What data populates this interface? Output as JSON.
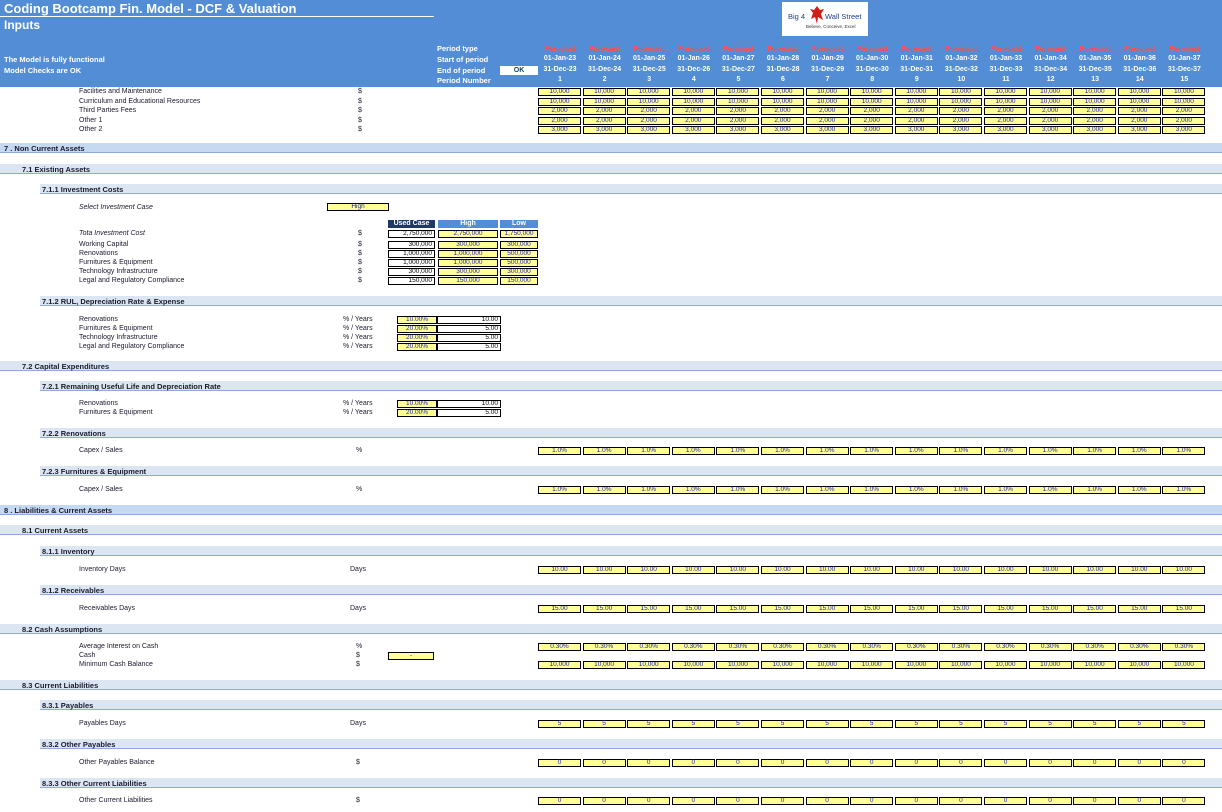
{
  "header": {
    "title": "Coding Bootcamp Fin. Model - DCF & Valuation",
    "subtitle": "Inputs",
    "status_functional": "The Model is fully functional",
    "status_checks": "Model Checks are OK",
    "ok_badge": "OK",
    "period_labels": [
      "Period type",
      "Start of period",
      "End of period",
      "Period Number"
    ],
    "periods": [
      {
        "type": "Forecast",
        "start": "01-Jan-23",
        "end": "31-Dec-23",
        "num": "1"
      },
      {
        "type": "Forecast",
        "start": "01-Jan-24",
        "end": "31-Dec-24",
        "num": "2"
      },
      {
        "type": "Forecast",
        "start": "01-Jan-25",
        "end": "31-Dec-25",
        "num": "3"
      },
      {
        "type": "Forecast",
        "start": "01-Jan-26",
        "end": "31-Dec-26",
        "num": "4"
      },
      {
        "type": "Forecast",
        "start": "01-Jan-27",
        "end": "31-Dec-27",
        "num": "5"
      },
      {
        "type": "Forecast",
        "start": "01-Jan-28",
        "end": "31-Dec-28",
        "num": "6"
      },
      {
        "type": "Forecast",
        "start": "01-Jan-29",
        "end": "31-Dec-29",
        "num": "7"
      },
      {
        "type": "Forecast",
        "start": "01-Jan-30",
        "end": "31-Dec-30",
        "num": "8"
      },
      {
        "type": "Forecast",
        "start": "01-Jan-31",
        "end": "31-Dec-31",
        "num": "9"
      },
      {
        "type": "Forecast",
        "start": "01-Jan-32",
        "end": "31-Dec-32",
        "num": "10"
      },
      {
        "type": "Forecast",
        "start": "01-Jan-33",
        "end": "31-Dec-33",
        "num": "11"
      },
      {
        "type": "Forecast",
        "start": "01-Jan-34",
        "end": "31-Dec-34",
        "num": "12"
      },
      {
        "type": "Forecast",
        "start": "01-Jan-35",
        "end": "31-Dec-35",
        "num": "13"
      },
      {
        "type": "Forecast",
        "start": "01-Jan-36",
        "end": "31-Dec-36",
        "num": "14"
      },
      {
        "type": "Forecast",
        "start": "01-Jan-37",
        "end": "31-Dec-37",
        "num": "15"
      }
    ]
  },
  "logo": {
    "line1": "Big 4",
    "line2": "Wall Street",
    "tagline": "Believe, Conceive, Excel"
  },
  "colors": {
    "header_blue": "#538dd5",
    "band": "#c5d9f1",
    "input_yellow": "#ffff99",
    "forecast_red": "#ff4d4d",
    "navy": "#1f3864"
  },
  "opex": [
    {
      "label": "Facilities and Maintenance",
      "unit": "$",
      "values": [
        "10,000",
        "10,000",
        "10,000",
        "10,000",
        "10,000",
        "10,000",
        "10,000",
        "10,000",
        "10,000",
        "10,000",
        "10,000",
        "10,000",
        "10,000",
        "10,000",
        "10,000"
      ]
    },
    {
      "label": "Curriculum and Educational Resources",
      "unit": "$",
      "values": [
        "10,000",
        "10,000",
        "10,000",
        "10,000",
        "10,000",
        "10,000",
        "10,000",
        "10,000",
        "10,000",
        "10,000",
        "10,000",
        "10,000",
        "10,000",
        "10,000",
        "10,000"
      ]
    },
    {
      "label": "Third Parties Fees",
      "unit": "$",
      "values": [
        "2,000",
        "2,000",
        "2,000",
        "2,000",
        "2,000",
        "2,000",
        "2,000",
        "2,000",
        "2,000",
        "2,000",
        "2,000",
        "2,000",
        "2,000",
        "2,000",
        "2,000"
      ]
    },
    {
      "label": "Other 1",
      "unit": "$",
      "values": [
        "2,000",
        "2,000",
        "2,000",
        "2,000",
        "2,000",
        "2,000",
        "2,000",
        "2,000",
        "2,000",
        "2,000",
        "2,000",
        "2,000",
        "2,000",
        "2,000",
        "2,000"
      ]
    },
    {
      "label": "Other 2",
      "unit": "$",
      "values": [
        "3,000",
        "3,000",
        "3,000",
        "3,000",
        "3,000",
        "3,000",
        "3,000",
        "3,000",
        "3,000",
        "3,000",
        "3,000",
        "3,000",
        "3,000",
        "3,000",
        "3,000"
      ]
    }
  ],
  "sections": {
    "s7": "7 .  Non Current Assets",
    "s7_1": "7.1   Existing Assets",
    "s7_1_1": "7.1.1      Investment Costs",
    "s7_1_2": "7.1.2      RUL, Depreciation Rate & Expense",
    "s7_2": "7.2   Capital Expenditures",
    "s7_2_1": "7.2.1      Remaining Useful Life and Depreciation Rate",
    "s7_2_2": "7.2.2      Renovations",
    "s7_2_3": "7.2.3      Furnitures & Equipment",
    "s8": "8 .  Liabilities & Current Assets",
    "s8_1": "8.1   Current Assets",
    "s8_1_1": "8.1.1      Inventory",
    "s8_1_2": "8.1.2      Receivables",
    "s8_2": "8.2   Cash Assumptions",
    "s8_3": "8.3   Current Liabilities",
    "s8_3_1": "8.3.1      Payables",
    "s8_3_2": "8.3.2      Other Payables",
    "s8_3_3": "8.3.3      Other Current Liabilities"
  },
  "investment": {
    "select_label": "Select Investment Case",
    "select_value": "High",
    "col_headers": [
      "Used Case",
      "High",
      "Low"
    ],
    "rows": [
      {
        "label": "Tota Investment Cost",
        "unit": "$",
        "values": [
          "2,750,000",
          "2,750,000",
          "1,750,000"
        ]
      },
      {
        "label": "Working Capital",
        "unit": "$",
        "values": [
          "300,000",
          "300,000",
          "300,000"
        ]
      },
      {
        "label": "Renovations",
        "unit": "$",
        "values": [
          "1,000,000",
          "1,000,000",
          "500,000"
        ]
      },
      {
        "label": "Furnitures & Equipment",
        "unit": "$",
        "values": [
          "1,000,000",
          "1,000,000",
          "500,000"
        ]
      },
      {
        "label": "Technology Infrastructure",
        "unit": "$",
        "values": [
          "300,000",
          "300,000",
          "300,000"
        ]
      },
      {
        "label": "Legal and Regulatory Compliance",
        "unit": "$",
        "values": [
          "150,000",
          "150,000",
          "150,000"
        ]
      }
    ]
  },
  "rul": [
    {
      "label": "Renovations",
      "unit": "% / Years",
      "rate": "10.00%",
      "years": "10.00"
    },
    {
      "label": "Furnitures & Equipment",
      "unit": "% / Years",
      "rate": "20.00%",
      "years": "5.00"
    },
    {
      "label": "Technology Infrastructure",
      "unit": "% / Years",
      "rate": "20.00%",
      "years": "5.00"
    },
    {
      "label": "Legal and Regulatory Compliance",
      "unit": "% / Years",
      "rate": "20.00%",
      "years": "5.00"
    }
  ],
  "capex_rul": [
    {
      "label": "Renovations",
      "unit": "% / Years",
      "rate": "10.00%",
      "years": "10.00"
    },
    {
      "label": "Furnitures & Equipment",
      "unit": "% / Years",
      "rate": "20.00%",
      "years": "5.00"
    }
  ],
  "rows": {
    "capex_renov": {
      "label": "Capex / Sales",
      "unit": "%",
      "value": "1.0%"
    },
    "capex_furn": {
      "label": "Capex / Sales",
      "unit": "%",
      "value": "1.0%"
    },
    "inventory": {
      "label": "Inventory Days",
      "unit": "Days",
      "value": "10.00"
    },
    "receivables": {
      "label": "Receivables Days",
      "unit": "Days",
      "value": "15.00"
    },
    "interest": {
      "label": "Average Interest on Cash",
      "unit": "%",
      "value": "0.30%"
    },
    "cash": {
      "label": "Cash",
      "unit": "$",
      "value": "-"
    },
    "min_cash": {
      "label": "Minimum Cash Balance",
      "unit": "$",
      "value": "10,000"
    },
    "payables": {
      "label": "Payables Days",
      "unit": "Days",
      "value": "5"
    },
    "other_payables": {
      "label": "Other Payables Balance",
      "unit": "$",
      "value": "0"
    },
    "other_cl": {
      "label": "Other Current Liabilities",
      "unit": "$",
      "value": "0"
    }
  }
}
